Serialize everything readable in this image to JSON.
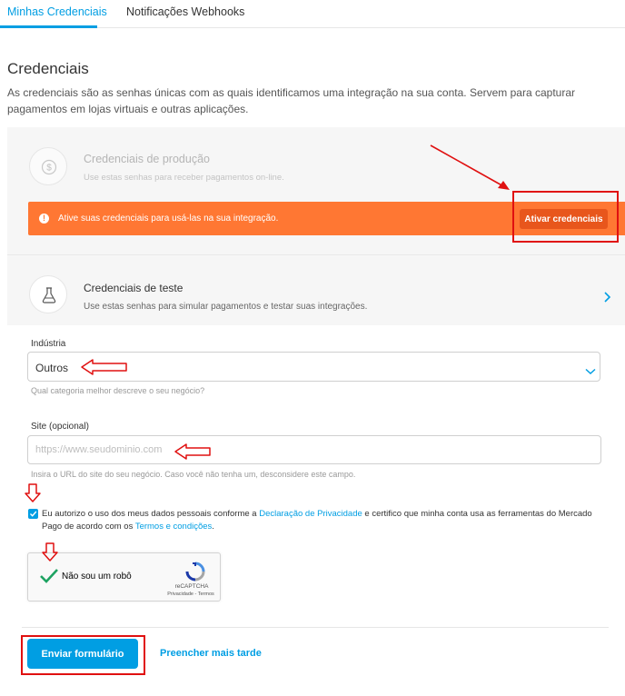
{
  "tabs": [
    {
      "label": "Minhas Credenciais",
      "active": true
    },
    {
      "label": "Notificações Webhooks",
      "active": false
    }
  ],
  "page": {
    "title": "Credenciais",
    "description": "As credenciais são as senhas únicas com as quais identificamos uma integração na sua conta. Servem para capturar pagamentos em lojas virtuais e outras aplicações."
  },
  "production": {
    "icon": "dollar-coin-icon",
    "title": "Credenciais de produção",
    "description": "Use estas senhas para receber pagamentos on-line.",
    "alert_icon": "exclamation-icon",
    "alert_text": "Ative suas credenciais para usá-las na sua integração.",
    "activate_label": "Ativar credenciais"
  },
  "test": {
    "icon": "flask-icon",
    "title": "Credenciais de teste",
    "description": "Use estas senhas para simular pagamentos e testar suas integrações.",
    "chevron_icon": "chevron-right-icon"
  },
  "form": {
    "industry_label": "Indústria",
    "industry_value": "Outros",
    "industry_hint": "Qual categoria melhor descreve o seu negócio?",
    "site_label": "Site (opcional)",
    "site_placeholder": "https://www.seudominio.com",
    "site_hint": "Insira o URL do site do seu negócio. Caso você não tenha um, desconsidere este campo.",
    "consent_checked": true,
    "consent_part1": "Eu autorizo o uso dos meus dados pessoais conforme a ",
    "consent_link1": "Declaração de Privacidade",
    "consent_part2": " e certifico que minha conta usa as ferramentas do Mercado Pago de acordo com os ",
    "consent_link2": "Termos e condições",
    "consent_part3": "."
  },
  "recaptcha": {
    "label": "Não sou um robô",
    "brand": "reCAPTCHA",
    "links": "Privacidade - Termos",
    "checked": true
  },
  "actions": {
    "submit_label": "Enviar formulário",
    "later_label": "Preencher mais tarde"
  },
  "colors": {
    "accent": "#009ee3",
    "alert": "#ff7733",
    "annotation": "#e01010"
  }
}
